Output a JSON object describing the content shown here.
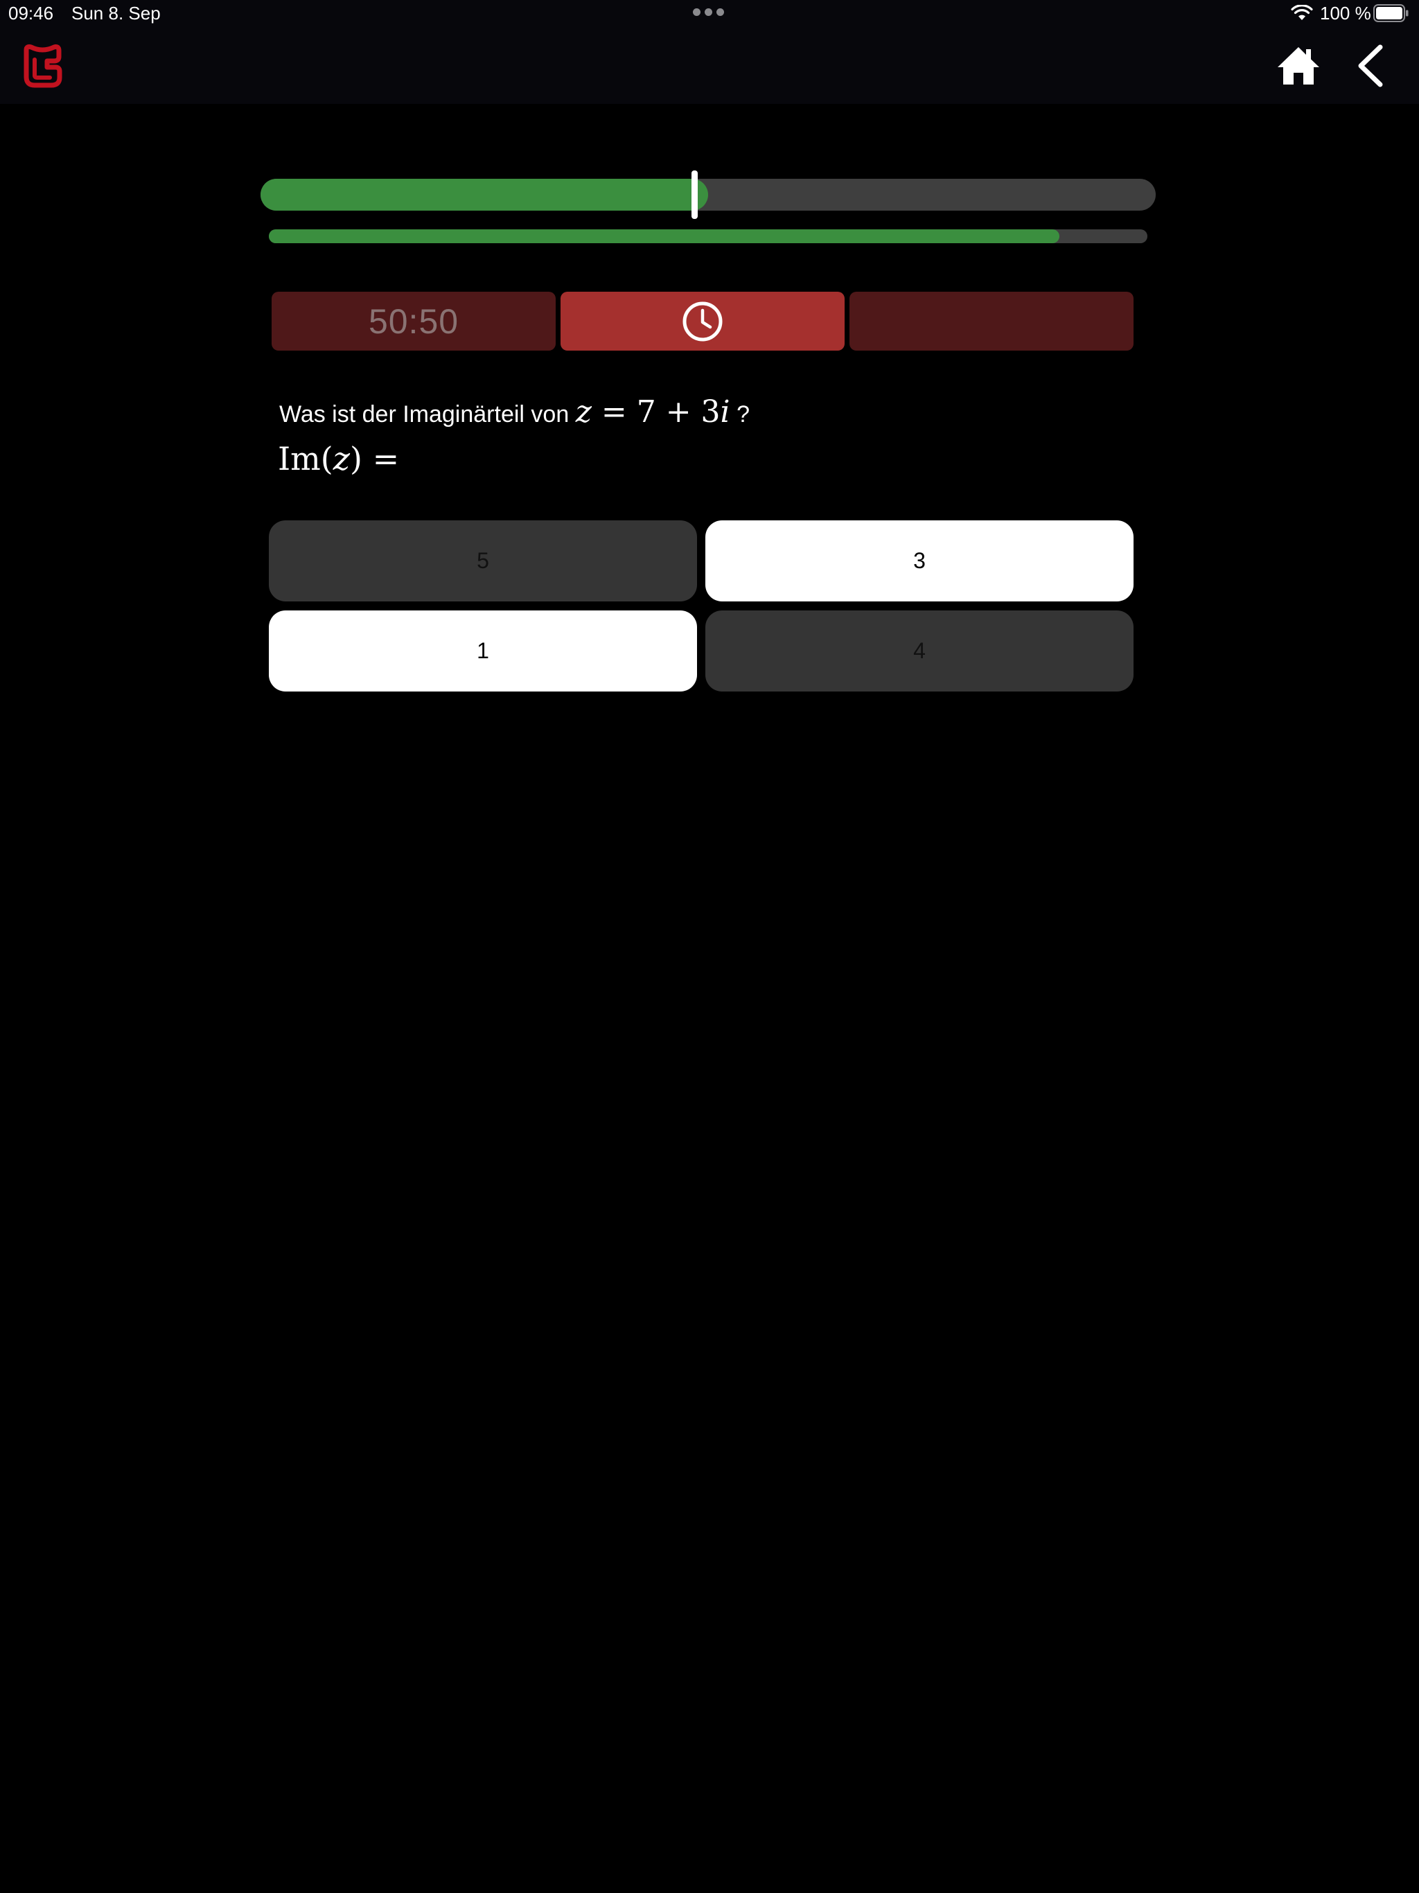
{
  "status_bar": {
    "time": "09:46",
    "date": "Sun 8. Sep",
    "battery": "100 %"
  },
  "header": {
    "logo_color": "#c1121f",
    "home_icon": "home-icon",
    "back_icon": "chevron-left-icon"
  },
  "progress": {
    "question_progress": 0.5,
    "time_remaining": 0.9
  },
  "jokers": {
    "fifty_fifty_label": "50:50",
    "time_icon": "clock-icon"
  },
  "question": {
    "text": "Was ist der Imaginärteil von",
    "math_z": "z",
    "math_eq": " = 7 + 3",
    "math_i": "i",
    "suffix": "?",
    "prompt_im": "Im(",
    "prompt_z": "z",
    "prompt_end": ") ="
  },
  "answers": [
    {
      "label": "5",
      "style": "dark"
    },
    {
      "label": "3",
      "style": "light"
    },
    {
      "label": "1",
      "style": "light"
    },
    {
      "label": "4",
      "style": "dark"
    }
  ],
  "colors": {
    "progress_green": "#3b8f3f",
    "joker_active": "#a5302e",
    "joker_inactive": "#4f1819"
  }
}
